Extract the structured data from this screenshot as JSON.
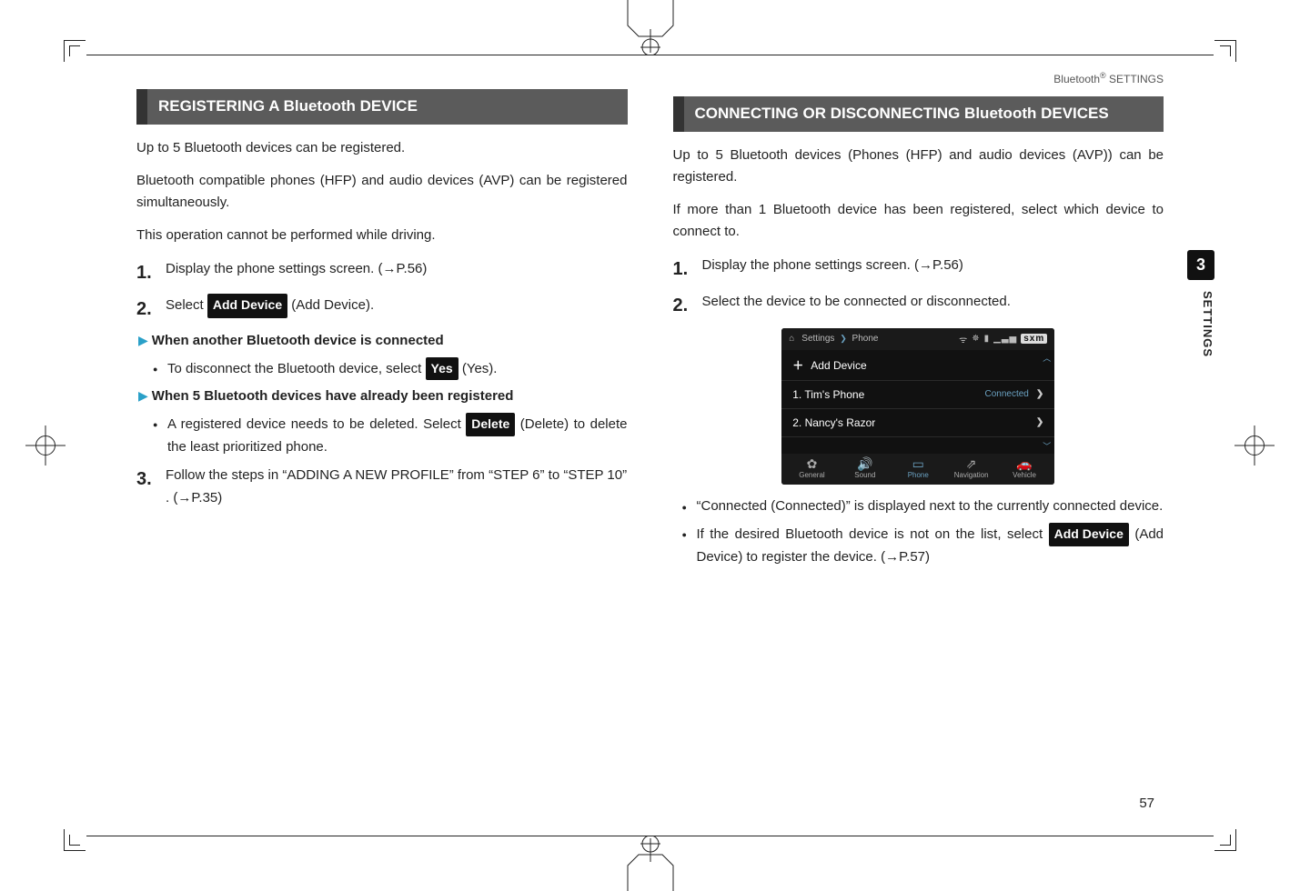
{
  "running_head": {
    "prefix": "Bluetooth",
    "sup": "®",
    "suffix": " SETTINGS"
  },
  "left": {
    "section_title": "REGISTERING A Bluetooth DEVICE",
    "p1": "Up to 5 Bluetooth devices can be registered.",
    "p2": "Bluetooth compatible phones (HFP) and audio devices (AVP) can be registered simultaneously.",
    "p3": "This operation cannot be performed while driving.",
    "step1_num": "1.",
    "step1_text": "Display the phone settings screen. (→P.56)",
    "step2_num": "2.",
    "step2_pre": "Select ",
    "step2_pill": "Add Device",
    "step2_post": " (Add Device).",
    "sub1_title": "When another Bluetooth device is connected",
    "sub1_bullet_pre": "To disconnect the Bluetooth device, select ",
    "sub1_bullet_pill": "Yes",
    "sub1_bullet_post": " (Yes).",
    "sub2_title": "When 5 Bluetooth devices have already been registered",
    "sub2_bullet_pre": "A registered device needs to be deleted. Select ",
    "sub2_bullet_pill": "Delete",
    "sub2_bullet_post": " (Delete) to delete the least prioritized phone.",
    "step3_num": "3.",
    "step3_text": "Follow the steps in “ADDING A NEW PROFILE” from “STEP 6” to “STEP 10” . (→P.35)"
  },
  "right": {
    "section_title": "CONNECTING OR DISCONNECTING Bluetooth DEVICES",
    "p1": "Up to 5 Bluetooth devices (Phones (HFP) and audio devices (AVP)) can be registered.",
    "p2": "If more than 1 Bluetooth device has been registered, select which device to connect to.",
    "step1_num": "1.",
    "step1_text": "Display the phone settings screen. (→P.56)",
    "step2_num": "2.",
    "step2_text": "Select the device to be connected or disconnected.",
    "bullet_connected": "“Connected (Connected)” is displayed next to the currently connected device.",
    "bullet_add_pre": "If the desired Bluetooth device is not on the list, select ",
    "bullet_add_pill": "Add Device",
    "bullet_add_post": " (Add Device) to register the device. (→P.57)"
  },
  "screenshot": {
    "breadcrumb_pre": "Settings",
    "breadcrumb_sep": "❯",
    "breadcrumb_cur": "Phone",
    "status_sxm": "sxm",
    "add_device": "Add Device",
    "row1_label": "1. Tim's Phone",
    "row1_status": "Connected",
    "row2_label": "2. Nancy's Razor",
    "tabs": {
      "general": "General",
      "sound": "Sound",
      "phone": "Phone",
      "navigation": "Navigation",
      "vehicle": "Vehicle"
    }
  },
  "side_tab": {
    "chapter": "3",
    "label": "SETTINGS"
  },
  "page_number": "57"
}
